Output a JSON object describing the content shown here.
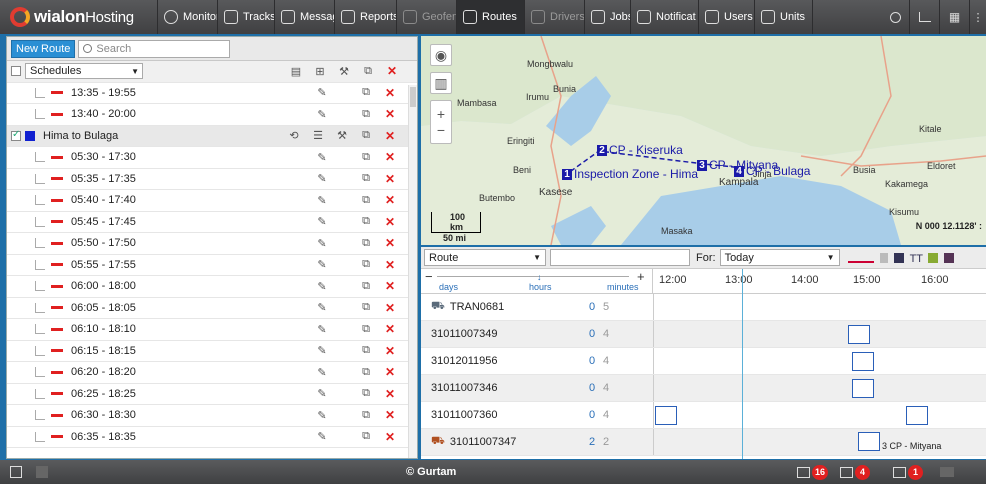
{
  "brand": {
    "name": "wialon",
    "suffix": "Hosting"
  },
  "nav": [
    {
      "label": "Monitori",
      "icon": "globe-icon",
      "active": false,
      "dim": false
    },
    {
      "label": "Tracks",
      "icon": "tracks-icon",
      "active": false,
      "dim": false
    },
    {
      "label": "Messag",
      "icon": "messages-icon",
      "active": false,
      "dim": false
    },
    {
      "label": "Reports",
      "icon": "reports-icon",
      "active": false,
      "dim": false
    },
    {
      "label": "Geofenc",
      "icon": "geofence-icon",
      "active": false,
      "dim": true
    },
    {
      "label": "Routes",
      "icon": "routes-icon",
      "active": true,
      "dim": false
    },
    {
      "label": "Drivers",
      "icon": "drivers-icon",
      "active": false,
      "dim": true
    },
    {
      "label": "Jobs",
      "icon": "jobs-icon",
      "active": false,
      "dim": false
    },
    {
      "label": "Notificat",
      "icon": "notifications-icon",
      "active": false,
      "dim": false
    },
    {
      "label": "Users",
      "icon": "users-icon",
      "active": false,
      "dim": false
    },
    {
      "label": "Units",
      "icon": "units-icon",
      "active": false,
      "dim": false
    }
  ],
  "left": {
    "new_route": "New Route",
    "search_placeholder": "Search",
    "schedules_select": "Schedules",
    "route_name": "Hima to Bulaga",
    "pre_times": [
      "13:35 - 19:55",
      "13:40 - 20:00"
    ],
    "times": [
      "05:30 - 17:30",
      "05:35 - 17:35",
      "05:40 - 17:40",
      "05:45 - 17:45",
      "05:50 - 17:50",
      "05:55 - 17:55",
      "06:00 - 18:00",
      "06:05 - 18:05",
      "06:10 - 18:10",
      "06:15 - 18:15",
      "06:20 - 18:20",
      "06:25 - 18:25",
      "06:30 - 18:30",
      "06:35 - 18:35"
    ]
  },
  "map": {
    "labels": {
      "mongbwalu": "Mongbwalu",
      "irumu": "Irumu",
      "bunia": "Bunia",
      "mambasa": "Mambasa",
      "eringiti": "Eringiti",
      "beni": "Beni",
      "butembo": "Butembo",
      "kasese": "Kasese",
      "kampala": "Kampala",
      "jinja": "Jinja",
      "busia": "Busia",
      "eldoret": "Eldoret",
      "kitale": "Kitale",
      "kakamega": "Kakamega",
      "kisumu": "Kisumu",
      "masaka": "Masaka"
    },
    "checkpoints": [
      {
        "num": "1",
        "label": "Inspection Zone - Hima"
      },
      {
        "num": "2",
        "label": "CP - Kiseruka"
      },
      {
        "num": "3",
        "label": "CP - Mityana"
      },
      {
        "num": "4",
        "label": "CP - Bulaga"
      }
    ],
    "scale_km": "100 km",
    "scale_mi": "50 mi",
    "coords": "N 000 12.1128' :"
  },
  "timeline": {
    "select": "Route",
    "for_label": "For:",
    "for_value": "Today",
    "zoom_days": "days",
    "zoom_hours": "hours",
    "zoom_minutes": "minutes",
    "hours": [
      "12:00",
      "13:00",
      "14:00",
      "15:00",
      "16:00"
    ],
    "rows": [
      {
        "name": "TRAN0681",
        "v1": "0",
        "v2": "5",
        "icon": "bus"
      },
      {
        "name": "31011007349",
        "v1": "0",
        "v2": "4",
        "icon": ""
      },
      {
        "name": "31012011956",
        "v1": "0",
        "v2": "4",
        "icon": ""
      },
      {
        "name": "31011007346",
        "v1": "0",
        "v2": "4",
        "icon": ""
      },
      {
        "name": "31011007360",
        "v1": "0",
        "v2": "4",
        "icon": ""
      },
      {
        "name": "31011007347",
        "v1": "2",
        "v2": "2",
        "icon": "truck"
      }
    ],
    "block_label": "3 CP - Mityana"
  },
  "status": {
    "copyright": "© Gurtam",
    "msg_count": "16",
    "alerts_count": "4",
    "img_count": "1"
  }
}
